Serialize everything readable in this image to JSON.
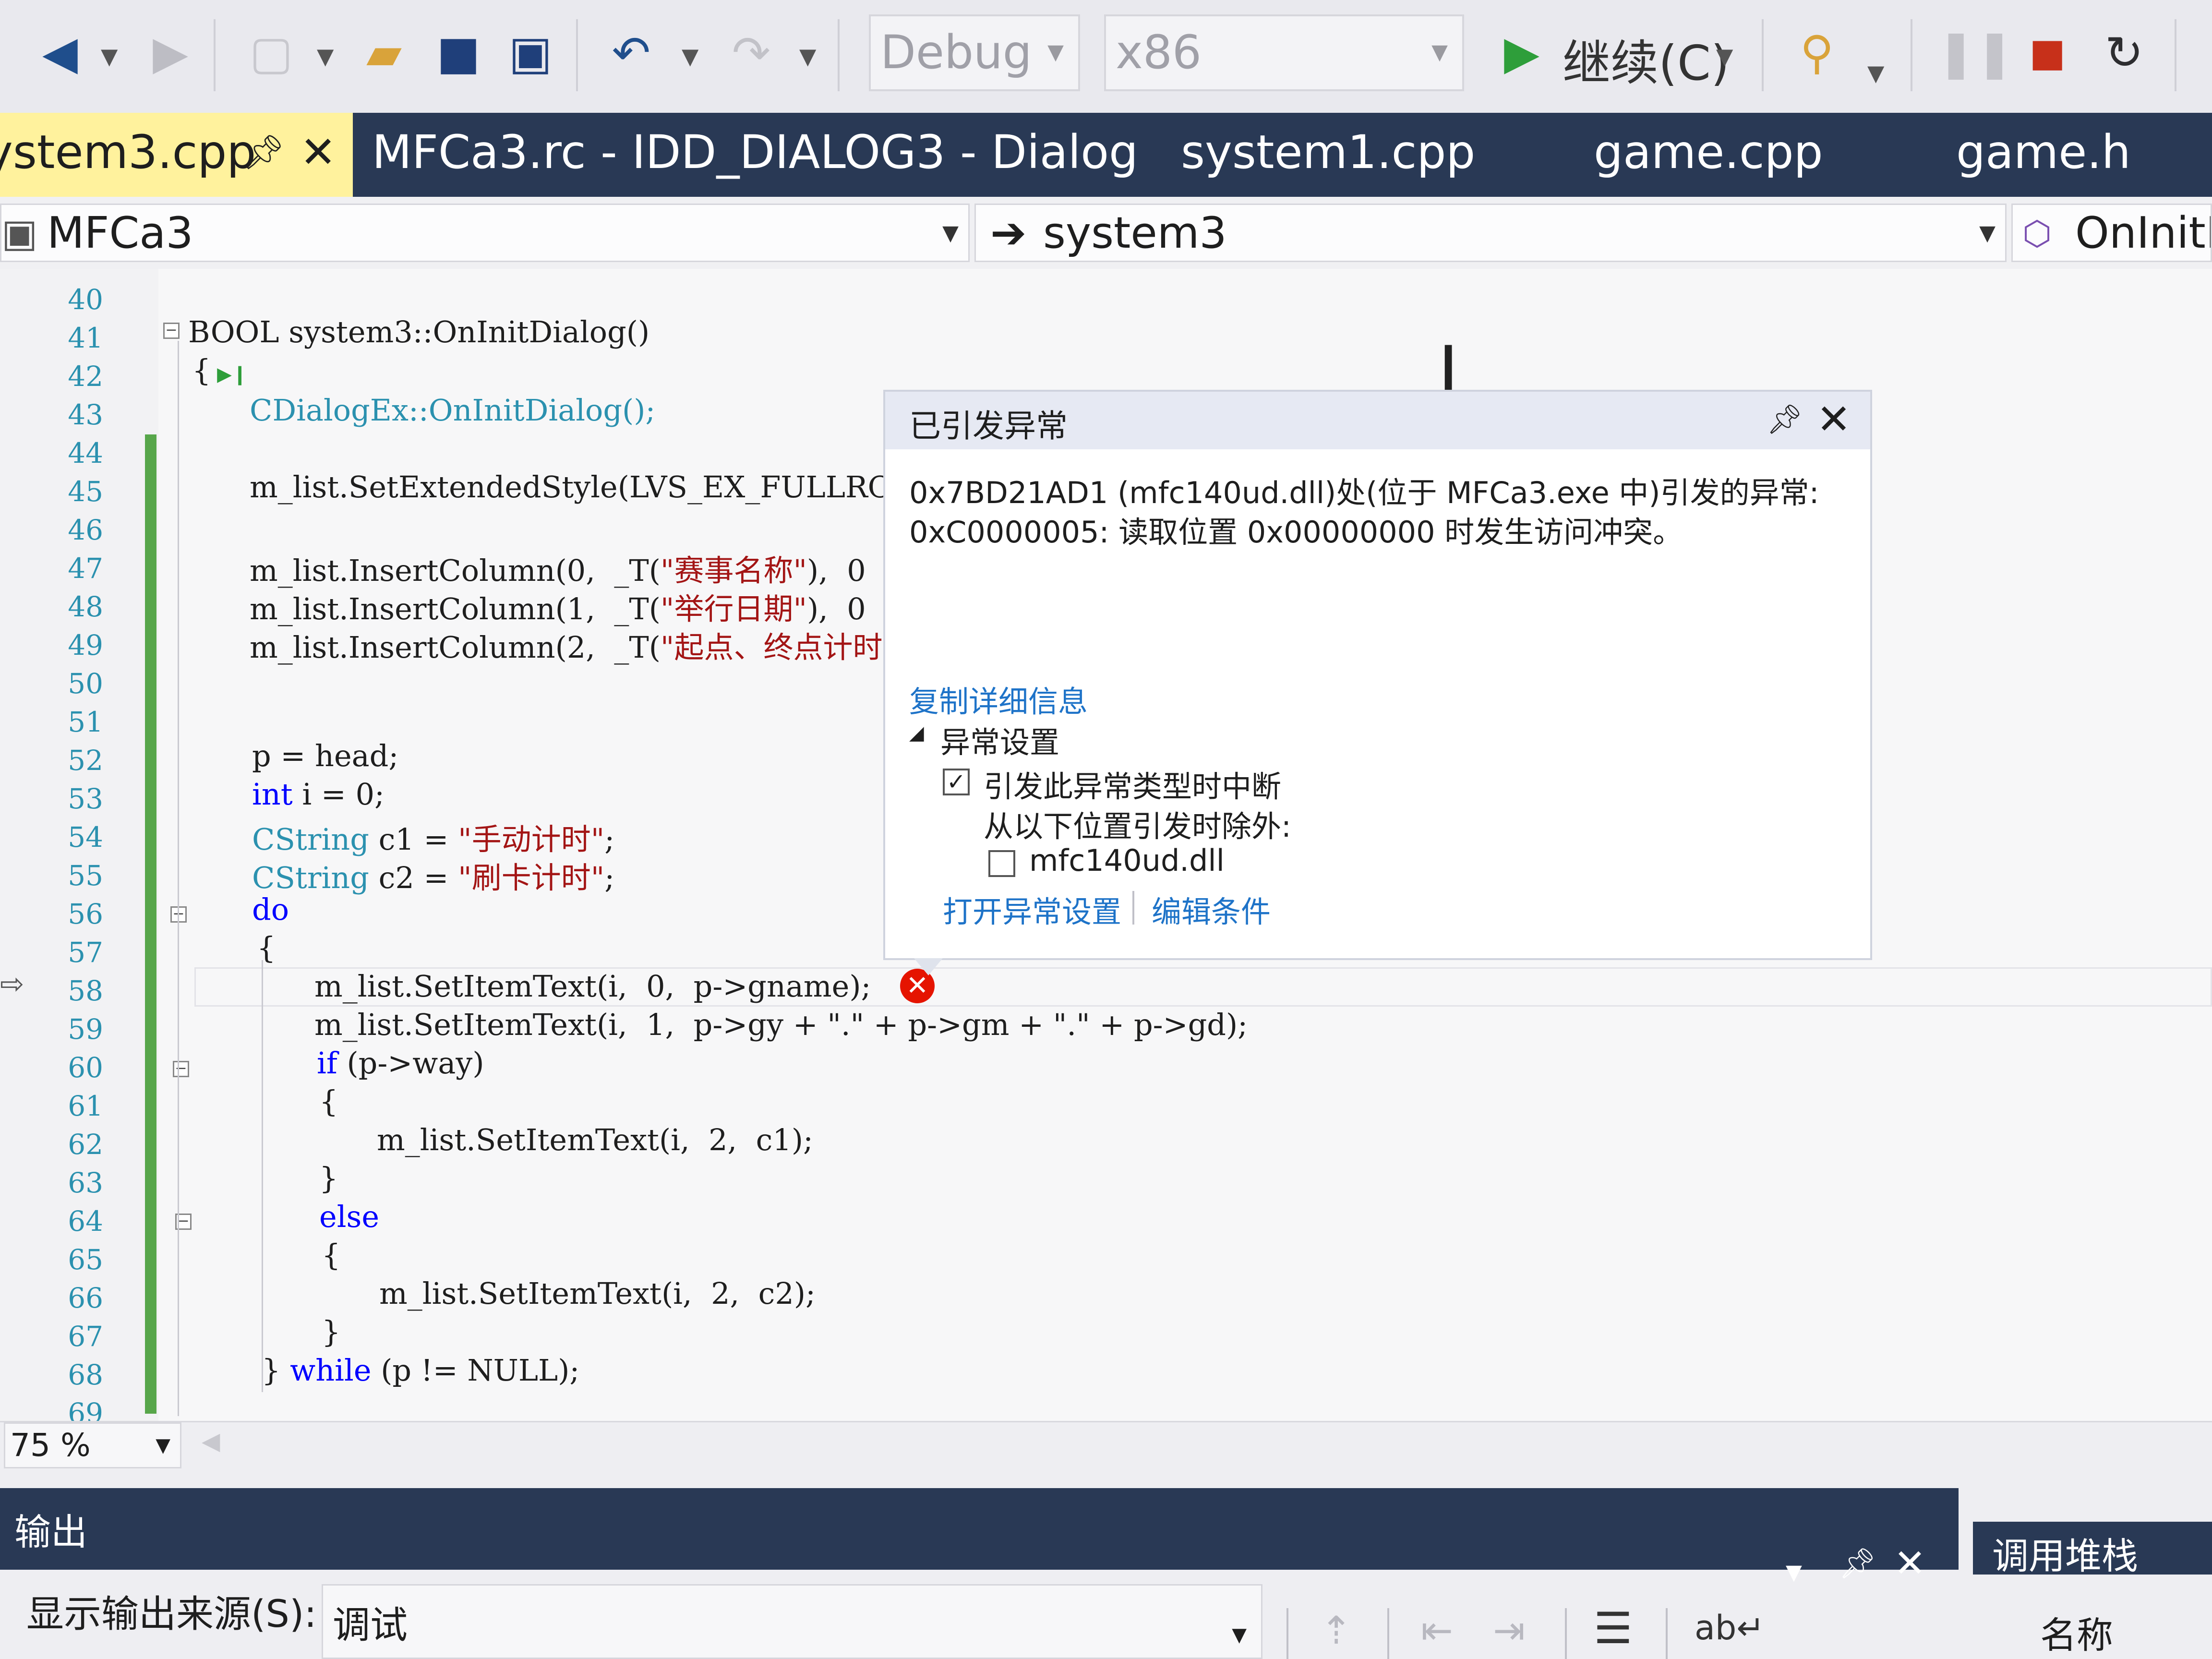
{
  "toolbar": {
    "config_combo": "Debug",
    "platform_combo": "x86",
    "continue_label": "继续(C)"
  },
  "tabs": {
    "active": {
      "label": "ystem3.cpp"
    },
    "others": [
      {
        "label": "MFCa3.rc - IDD_DIALOG3 - Dialog"
      },
      {
        "label": "system1.cpp"
      },
      {
        "label": "game.cpp"
      },
      {
        "label": "game.h"
      }
    ]
  },
  "navbar": {
    "project": "MFCa3",
    "scope": "system3",
    "member": "OnInitD"
  },
  "editor": {
    "line_numbers": [
      "40",
      "41",
      "42",
      "43",
      "44",
      "45",
      "46",
      "47",
      "48",
      "49",
      "50",
      "51",
      "52",
      "53",
      "54",
      "55",
      "56",
      "57",
      "58",
      "59",
      "60",
      "61",
      "62",
      "63",
      "64",
      "65",
      "66",
      "67",
      "68",
      "69"
    ],
    "code": {
      "l41_type": "BOOL",
      "l41_rest": " system3::OnInitDialog()",
      "l42": "{",
      "l43": "CDialogEx::OnInitDialog();",
      "l45": "m_list.SetExtendedStyle(LVS_EX_FULLROWSE",
      "l47_a": "m_list.InsertColumn(0,  _T(",
      "l47_s": "\"赛事名称\"",
      "l47_b": "),  0",
      "l48_a": "m_list.InsertColumn(1,  _T(",
      "l48_s": "\"举行日期\"",
      "l48_b": "),  0",
      "l49_a": "m_list.InsertColumn(2,  _T(",
      "l49_s": "\"起点、终点计时",
      "l52": "p = head;",
      "l53_kw": "int",
      "l53_rest": " i = 0;",
      "l54_ty": "CString",
      "l54_mid": " c1 = ",
      "l54_s": "\"手动计时\"",
      "l54_end": ";",
      "l55_ty": "CString",
      "l55_mid": " c2 = ",
      "l55_s": "\"刷卡计时\"",
      "l55_end": ";",
      "l56_kw": "do",
      "l57": "{",
      "l58": "m_list.SetItemText(i,  0,  p->gname);",
      "l59": "m_list.SetItemText(i,  1,  p->gy + \".\" + p->gm + \".\" + p->gd);",
      "l60_kw": "if",
      "l60_rest": " (p->way)",
      "l61": "{",
      "l62": "m_list.SetItemText(i,  2,  c1);",
      "l63": "}",
      "l64_kw": "else",
      "l65": "{",
      "l66": "m_list.SetItemText(i,  2,  c2);",
      "l67": "}",
      "l68_a": "} ",
      "l68_kw": "while",
      "l68_b": " (p != NULL);"
    }
  },
  "exception_popup": {
    "title": "已引发异常",
    "message_line1": "0x7BD21AD1 (mfc140ud.dll)处(位于 MFCa3.exe 中)引发的异常:",
    "message_line2": "0xC0000005: 读取位置 0x00000000 时发生访问冲突。",
    "copy_details": "复制详细信息",
    "settings_header": "异常设置",
    "break_when_thrown": "引发此异常类型时中断",
    "break_when_thrown_checked": true,
    "except_when_from": "从以下位置引发时除外:",
    "module_exception": "mfc140ud.dll",
    "module_exception_checked": false,
    "open_settings": "打开异常设置",
    "edit_conditions": "编辑条件"
  },
  "zoom": "75 %",
  "output_panel": {
    "title": "输出",
    "source_label": "显示输出来源(S):",
    "source_value": "调试"
  },
  "callstack_panel": {
    "title": "调用堆栈",
    "column_name": "名称"
  }
}
